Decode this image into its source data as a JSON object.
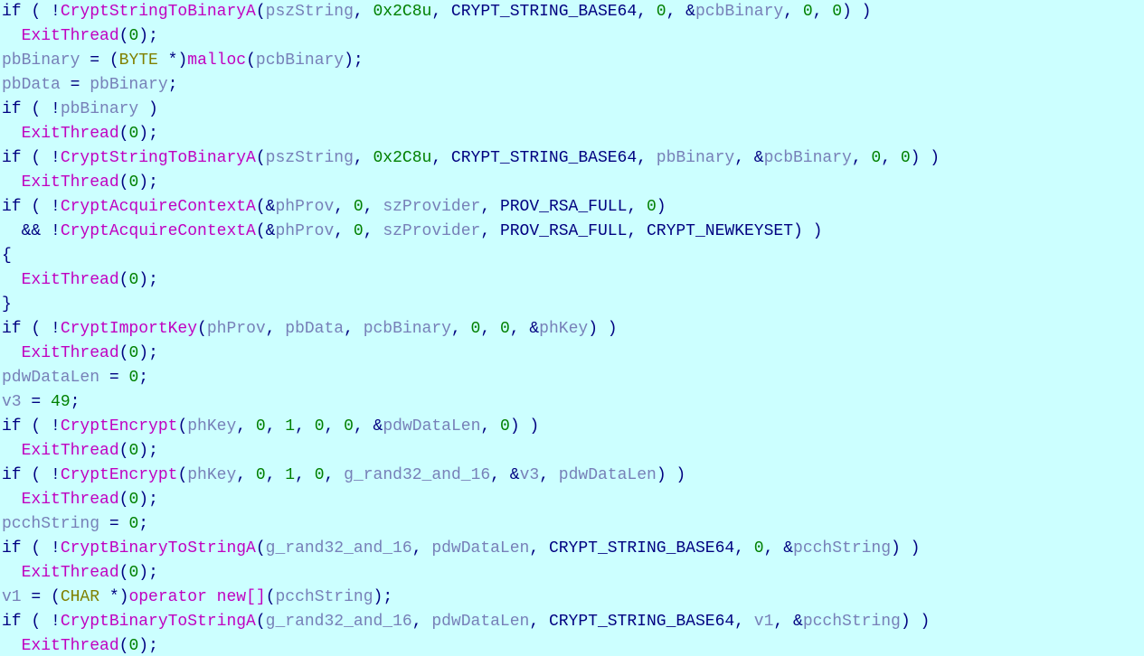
{
  "code": {
    "tokens": [
      "if ( !",
      "CryptStringToBinaryA",
      "(",
      "pszString",
      ", ",
      "0x2C8u",
      ", CRYPT_STRING_BASE64, ",
      "0",
      ", &",
      "pcbBinary",
      ", ",
      "0",
      ", ",
      "0",
      ") )",
      "\n",
      "  ",
      "ExitThread",
      "(",
      "0",
      ");",
      "\n",
      "pbBinary",
      " = (",
      "BYTE",
      " *)",
      "malloc",
      "(",
      "pcbBinary",
      ");",
      "\n",
      "pbData",
      " = ",
      "pbBinary",
      ";",
      "\n",
      "if ( !",
      "pbBinary",
      " )",
      "\n",
      "  ",
      "ExitThread",
      "(",
      "0",
      ");",
      "\n",
      "if ( !",
      "CryptStringToBinaryA",
      "(",
      "pszString",
      ", ",
      "0x2C8u",
      ", CRYPT_STRING_BASE64, ",
      "pbBinary",
      ", &",
      "pcbBinary",
      ", ",
      "0",
      ", ",
      "0",
      ") )",
      "\n",
      "  ",
      "ExitThread",
      "(",
      "0",
      ");",
      "\n",
      "if ( !",
      "CryptAcquireContextA",
      "(&",
      "phProv",
      ", ",
      "0",
      ", ",
      "szProvider",
      ", PROV_RSA_FULL, ",
      "0",
      ")",
      "\n",
      "  && !",
      "CryptAcquireContextA",
      "(&",
      "phProv",
      ", ",
      "0",
      ", ",
      "szProvider",
      ", PROV_RSA_FULL, CRYPT_NEWKEYSET) )",
      "\n",
      "{",
      "\n",
      "  ",
      "ExitThread",
      "(",
      "0",
      ");",
      "\n",
      "}",
      "\n",
      "if ( !",
      "CryptImportKey",
      "(",
      "phProv",
      ", ",
      "pbData",
      ", ",
      "pcbBinary",
      ", ",
      "0",
      ", ",
      "0",
      ", &",
      "phKey",
      ") )",
      "\n",
      "  ",
      "ExitThread",
      "(",
      "0",
      ");",
      "\n",
      "pdwDataLen",
      " = ",
      "0",
      ";",
      "\n",
      "v3",
      " = ",
      "49",
      ";",
      "\n",
      "if ( !",
      "CryptEncrypt",
      "(",
      "phKey",
      ", ",
      "0",
      ", ",
      "1",
      ", ",
      "0",
      ", ",
      "0",
      ", &",
      "pdwDataLen",
      ", ",
      "0",
      ") )",
      "\n",
      "  ",
      "ExitThread",
      "(",
      "0",
      ");",
      "\n",
      "if ( !",
      "CryptEncrypt",
      "(",
      "phKey",
      ", ",
      "0",
      ", ",
      "1",
      ", ",
      "0",
      ", ",
      "g_rand32_and_16",
      ", &",
      "v3",
      ", ",
      "pdwDataLen",
      ") )",
      "\n",
      "  ",
      "ExitThread",
      "(",
      "0",
      ");",
      "\n",
      "pcchString",
      " = ",
      "0",
      ";",
      "\n",
      "if ( !",
      "CryptBinaryToStringA",
      "(",
      "g_rand32_and_16",
      ", ",
      "pdwDataLen",
      ", CRYPT_STRING_BASE64, ",
      "0",
      ", &",
      "pcchString",
      ") )",
      "\n",
      "  ",
      "ExitThread",
      "(",
      "0",
      ");",
      "\n",
      "v1",
      " = (",
      "CHAR",
      " *)",
      "operator new[]",
      "(",
      "pcchString",
      ");",
      "\n",
      "if ( !",
      "CryptBinaryToStringA",
      "(",
      "g_rand32_and_16",
      ", ",
      "pdwDataLen",
      ", CRYPT_STRING_BASE64, ",
      "v1",
      ", &",
      "pcchString",
      ") )",
      "\n",
      "  ",
      "ExitThread",
      "(",
      "0",
      ");"
    ],
    "classes": [
      "t-kw",
      "t-fn",
      "t-plain",
      "t-var",
      "t-plain",
      "t-num",
      "t-plain",
      "t-num",
      "t-plain",
      "t-var",
      "t-plain",
      "t-num",
      "t-plain",
      "t-num",
      "t-plain",
      "nl",
      "t-plain",
      "t-fn",
      "t-plain",
      "t-num",
      "t-plain",
      "nl",
      "t-var",
      "t-plain",
      "t-str",
      "t-plain",
      "t-fn",
      "t-plain",
      "t-var",
      "t-plain",
      "nl",
      "t-var",
      "t-plain",
      "t-var",
      "t-plain",
      "nl",
      "t-kw",
      "t-var",
      "t-plain",
      "nl",
      "t-plain",
      "t-fn",
      "t-plain",
      "t-num",
      "t-plain",
      "nl",
      "t-kw",
      "t-fn",
      "t-plain",
      "t-var",
      "t-plain",
      "t-num",
      "t-plain",
      "t-var",
      "t-plain",
      "t-var",
      "t-plain",
      "t-num",
      "t-plain",
      "t-num",
      "t-plain",
      "nl",
      "t-plain",
      "t-fn",
      "t-plain",
      "t-num",
      "t-plain",
      "nl",
      "t-kw",
      "t-fn",
      "t-plain",
      "t-var",
      "t-plain",
      "t-num",
      "t-plain",
      "t-var",
      "t-plain",
      "t-num",
      "t-plain",
      "nl",
      "t-plain",
      "t-fn",
      "t-plain",
      "t-var",
      "t-plain",
      "t-num",
      "t-plain",
      "t-var",
      "t-plain",
      "nl",
      "t-plain",
      "nl",
      "t-plain",
      "t-fn",
      "t-plain",
      "t-num",
      "t-plain",
      "nl",
      "t-plain",
      "nl",
      "t-kw",
      "t-fn",
      "t-plain",
      "t-var",
      "t-plain",
      "t-var",
      "t-plain",
      "t-var",
      "t-plain",
      "t-num",
      "t-plain",
      "t-num",
      "t-plain",
      "t-var",
      "t-plain",
      "nl",
      "t-plain",
      "t-fn",
      "t-plain",
      "t-num",
      "t-plain",
      "nl",
      "t-var",
      "t-plain",
      "t-num",
      "t-plain",
      "nl",
      "t-var",
      "t-plain",
      "t-num",
      "t-plain",
      "nl",
      "t-kw",
      "t-fn",
      "t-plain",
      "t-var",
      "t-plain",
      "t-num",
      "t-plain",
      "t-num",
      "t-plain",
      "t-num",
      "t-plain",
      "t-num",
      "t-plain",
      "t-var",
      "t-plain",
      "t-num",
      "t-plain",
      "nl",
      "t-plain",
      "t-fn",
      "t-plain",
      "t-num",
      "t-plain",
      "nl",
      "t-kw",
      "t-fn",
      "t-plain",
      "t-var",
      "t-plain",
      "t-num",
      "t-plain",
      "t-num",
      "t-plain",
      "t-num",
      "t-plain",
      "t-var",
      "t-plain",
      "t-var",
      "t-plain",
      "t-var",
      "t-plain",
      "nl",
      "t-plain",
      "t-fn",
      "t-plain",
      "t-num",
      "t-plain",
      "nl",
      "t-var",
      "t-plain",
      "t-num",
      "t-plain",
      "nl",
      "t-kw",
      "t-fn",
      "t-plain",
      "t-var",
      "t-plain",
      "t-var",
      "t-plain",
      "t-num",
      "t-plain",
      "t-var",
      "t-plain",
      "nl",
      "t-plain",
      "t-fn",
      "t-plain",
      "t-num",
      "t-plain",
      "nl",
      "t-var",
      "t-plain",
      "t-str",
      "t-plain",
      "t-fn",
      "t-plain",
      "t-var",
      "t-plain",
      "nl",
      "t-kw",
      "t-fn",
      "t-plain",
      "t-var",
      "t-plain",
      "t-var",
      "t-plain",
      "t-var",
      "t-plain",
      "t-var",
      "t-plain",
      "nl",
      "t-plain",
      "t-fn",
      "t-plain",
      "t-num",
      "t-plain"
    ]
  }
}
